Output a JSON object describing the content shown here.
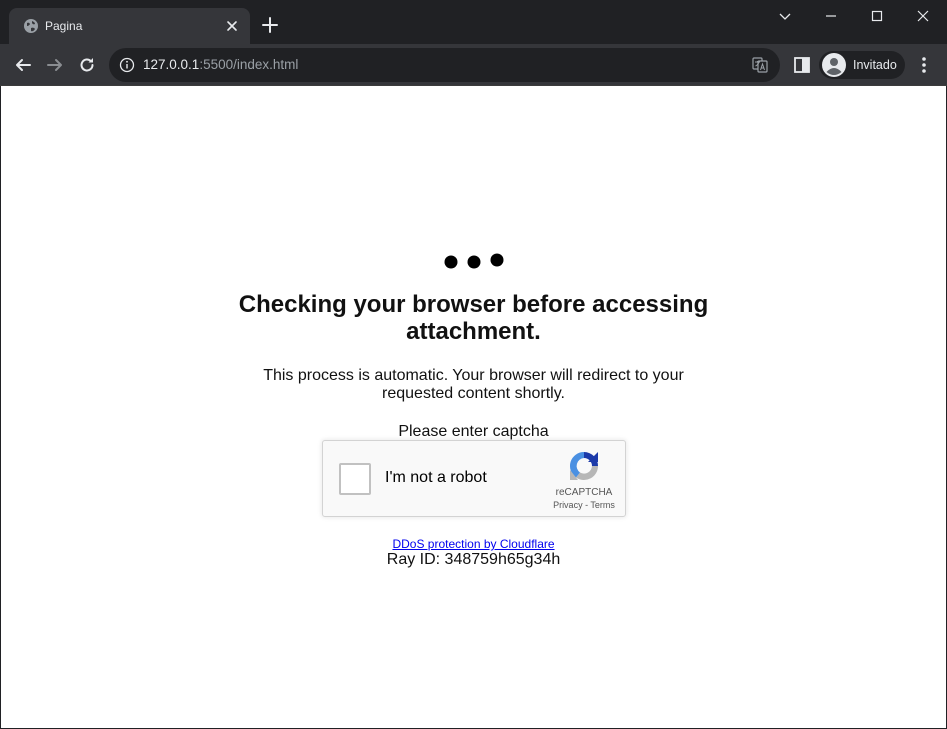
{
  "browser": {
    "tab": {
      "title": "Pagina",
      "favicon": "globe-icon"
    },
    "address": {
      "host": "127.0.0.1",
      "rest": ":5500/index.html"
    },
    "profile_name": "Invitado"
  },
  "page": {
    "heading_line1": "Checking your browser before accessing",
    "heading_line2": "attachment.",
    "sub_line1": "This process is automatic. Your browser will redirect to your",
    "sub_line2": "requested content shortly.",
    "captcha_prompt": "Please enter captcha",
    "captcha": {
      "label": "I'm not a robot",
      "brand": "reCAPTCHA",
      "privacy": "Privacy",
      "separator": " - ",
      "terms": "Terms"
    },
    "ddos_link": "DDoS protection by Cloudflare",
    "ray_id": "Ray ID: 348759h65g34h"
  },
  "colors": {
    "chrome_dark": "#202124",
    "chrome_toolbar": "#35363a",
    "link": "#0000ee",
    "recaptcha_blue": "#1c3aa9",
    "recaptcha_light_blue": "#4a90e2"
  }
}
